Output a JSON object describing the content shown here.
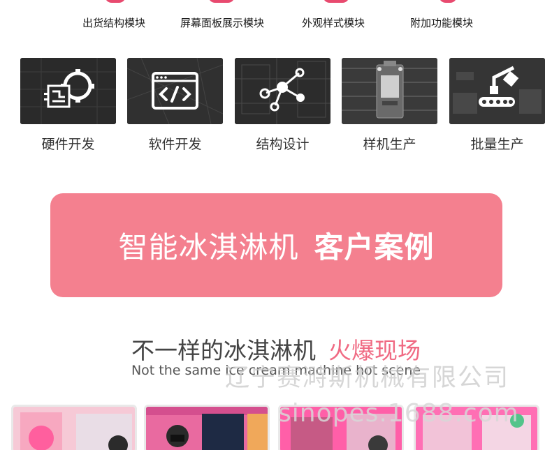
{
  "modules": [
    "出货结构模块",
    "屏幕面板展示模块",
    "外观样式模块",
    "附加功能模块"
  ],
  "services": [
    {
      "label": "硬件开发",
      "icon": "circuit-gear-icon"
    },
    {
      "label": "软件开发",
      "icon": "code-window-icon"
    },
    {
      "label": "结构设计",
      "icon": "network-nodes-icon"
    },
    {
      "label": "样机生产",
      "icon": "circuit-board-icon"
    },
    {
      "label": "批量生产",
      "icon": "assembly-line-icon"
    }
  ],
  "banner": {
    "title": "智能冰淇淋机",
    "title_bold": "客户案例",
    "color": "#f4808f"
  },
  "scene": {
    "title": "不一样的冰淇淋机",
    "title_hot": "火爆现场",
    "subtitle": "Not the same ice cream machine hot scene",
    "hot_color": "#f06a83"
  },
  "watermarks": {
    "company": "辽宁赛溡斯机械有限公司",
    "site": "sinopes.1688.com"
  }
}
